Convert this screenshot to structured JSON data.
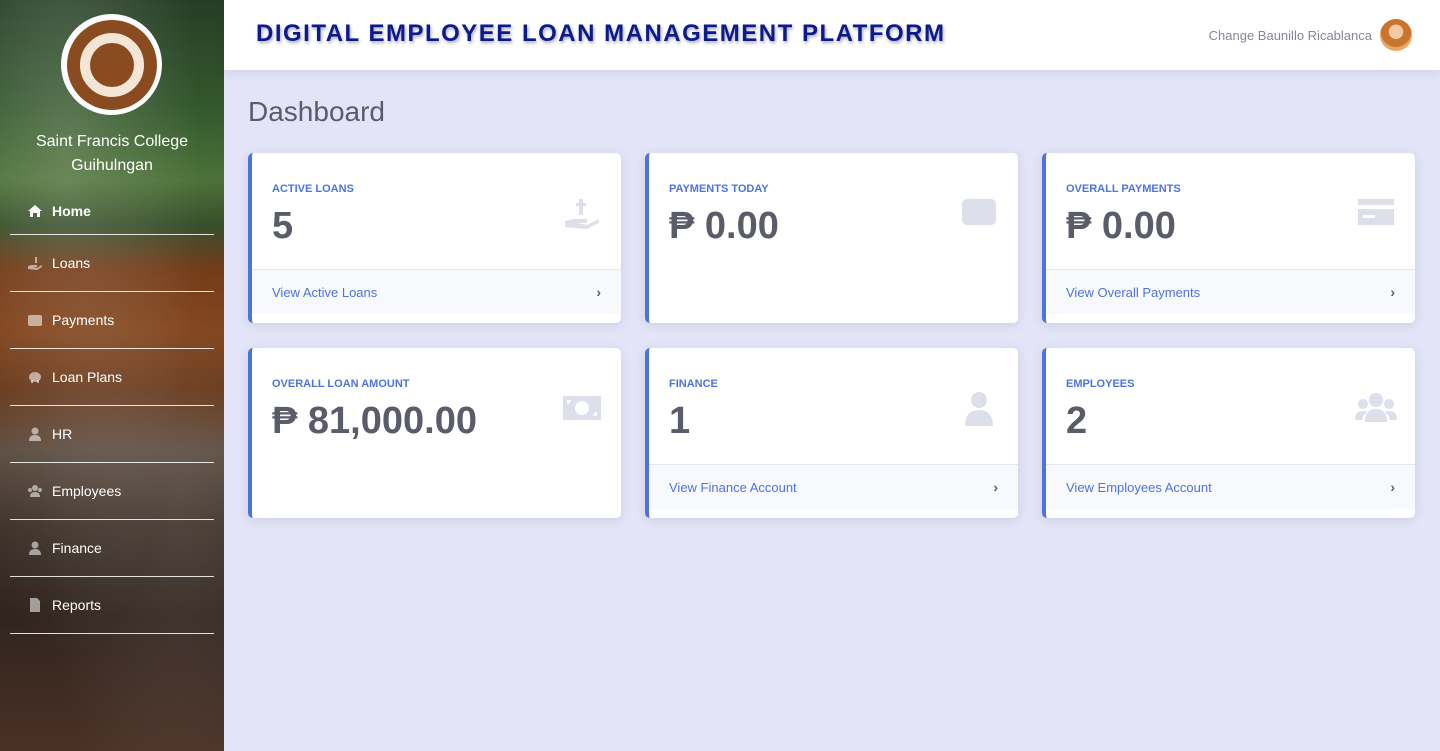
{
  "sidebar": {
    "college_name": "Saint Francis College Guihulngan",
    "items": [
      {
        "label": "Home",
        "icon": "home-icon"
      },
      {
        "label": "Loans",
        "icon": "hand-holding-dollar-icon"
      },
      {
        "label": "Payments",
        "icon": "wallet-icon"
      },
      {
        "label": "Loan Plans",
        "icon": "piggy-bank-icon"
      },
      {
        "label": "HR",
        "icon": "user-icon"
      },
      {
        "label": "Employees",
        "icon": "users-icon"
      },
      {
        "label": "Finance",
        "icon": "user-icon"
      },
      {
        "label": "Reports",
        "icon": "file-icon"
      }
    ]
  },
  "header": {
    "title": "DIGITAL EMPLOYEE LOAN MANAGEMENT PLATFORM",
    "user_name": "Change Baunillo Ricablanca"
  },
  "main": {
    "page_title": "Dashboard",
    "cards": [
      {
        "label": "ACTIVE LOANS",
        "value": "5",
        "icon": "hand-holding-dollar-icon",
        "link": "View Active Loans"
      },
      {
        "label": "PAYMENTS TODAY",
        "value": "₱ 0.00",
        "icon": "wallet-icon",
        "link": ""
      },
      {
        "label": "OVERALL PAYMENTS",
        "value": "₱ 0.00",
        "icon": "credit-card-icon",
        "link": "View Overall Payments"
      },
      {
        "label": "OVERALL LOAN AMOUNT",
        "value": "₱ 81,000.00",
        "icon": "money-bill-icon",
        "link": ""
      },
      {
        "label": "FINANCE",
        "value": "1",
        "icon": "user-icon",
        "link": "View Finance Account"
      },
      {
        "label": "EMPLOYEES",
        "value": "2",
        "icon": "users-icon",
        "link": "View Employees Account"
      }
    ]
  },
  "colors": {
    "accent": "#4e73df",
    "title": "#0d1a8c",
    "background": "#e3e4f7"
  }
}
